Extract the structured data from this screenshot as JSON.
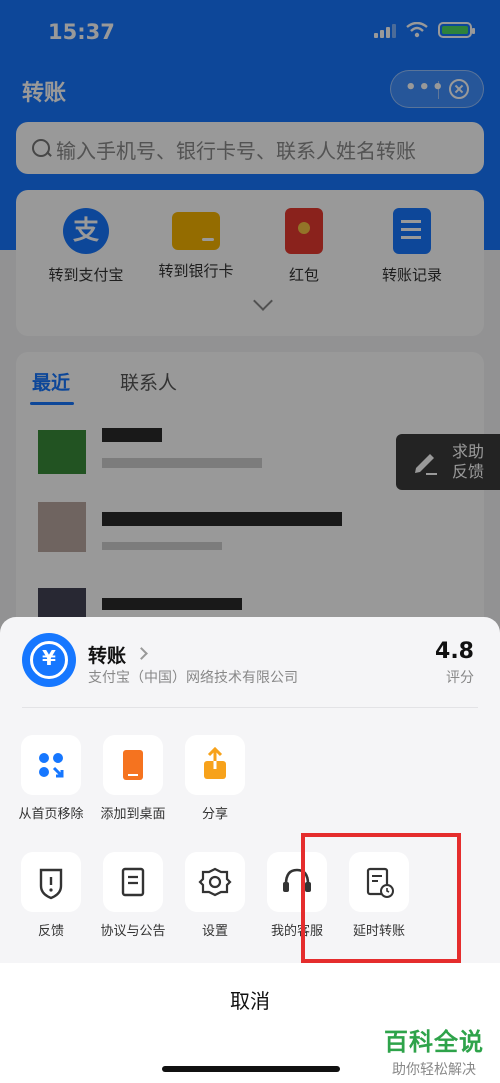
{
  "status_bar": {
    "time": "15:37"
  },
  "page": {
    "title": "转账",
    "search_placeholder": "输入手机号、银行卡号、联系人姓名转账",
    "quick_actions": [
      {
        "label": "转到支付宝",
        "icon": "alipay-icon"
      },
      {
        "label": "转到银行卡",
        "icon": "bank-card-icon"
      },
      {
        "label": "红包",
        "icon": "red-packet-icon"
      },
      {
        "label": "转账记录",
        "icon": "record-icon"
      }
    ],
    "tabs": {
      "recent": "最近",
      "contacts": "联系人"
    },
    "help_float": {
      "line1": "求助",
      "line2": "反馈"
    }
  },
  "sheet": {
    "app_name": "转账",
    "company": "支付宝（中国）网络技术有限公司",
    "rating": "4.8",
    "rating_label": "评分",
    "row1": [
      {
        "label": "从首页移除",
        "icon": "remove-from-home-icon"
      },
      {
        "label": "添加到桌面",
        "icon": "add-to-desktop-icon"
      },
      {
        "label": "分享",
        "icon": "share-icon"
      }
    ],
    "row2": [
      {
        "label": "反馈",
        "icon": "feedback-icon"
      },
      {
        "label": "协议与公告",
        "icon": "agreement-icon"
      },
      {
        "label": "设置",
        "icon": "settings-icon"
      },
      {
        "label": "我的客服",
        "icon": "customer-service-icon"
      },
      {
        "label": "延时转账",
        "icon": "delayed-transfer-icon"
      }
    ],
    "cancel": "取消"
  },
  "watermark": {
    "main": "百科全说",
    "sub": "助你轻松解决"
  },
  "colors": {
    "brand_blue": "#1677ff",
    "highlight_red": "#e52d2d",
    "watermark_green": "#2ea34a"
  }
}
